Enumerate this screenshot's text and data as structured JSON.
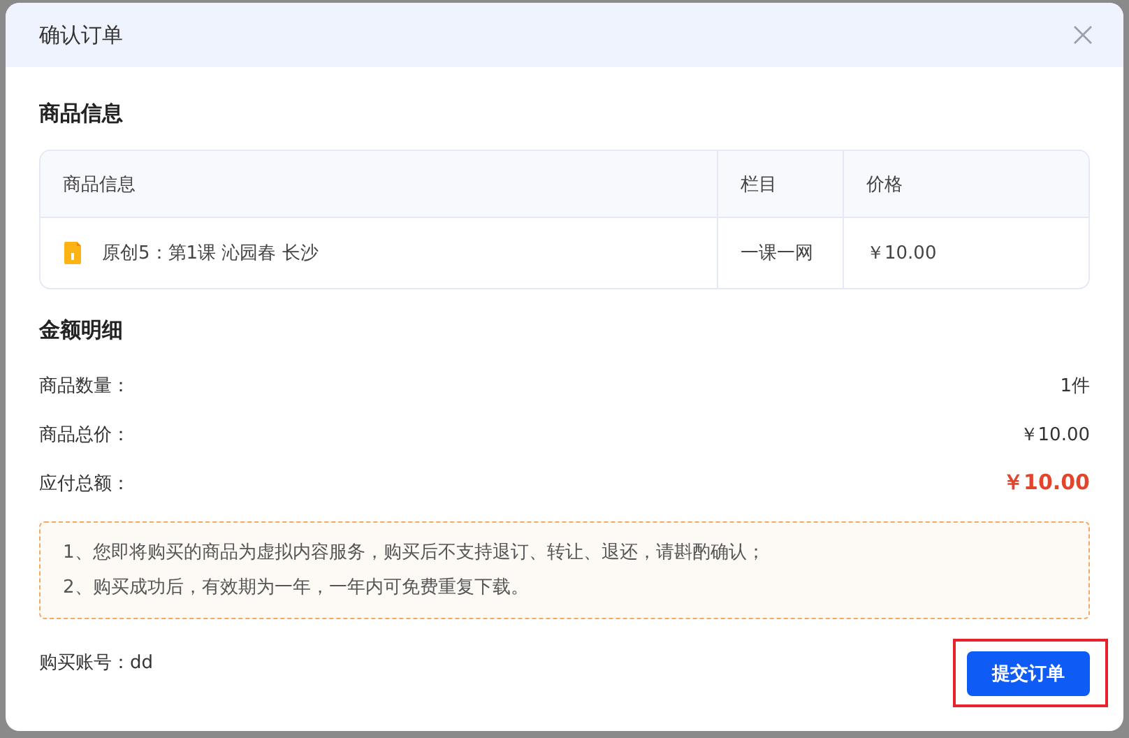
{
  "dialog": {
    "title": "确认订单"
  },
  "product_section": {
    "title": "商品信息",
    "table": {
      "columns": [
        "商品信息",
        "栏目",
        "价格"
      ],
      "rows": [
        {
          "name": "原创5：第1课 沁园春 长沙",
          "category": "一课一网",
          "price": "￥10.00"
        }
      ]
    }
  },
  "amount_section": {
    "title": "金额明细",
    "rows": [
      {
        "label": "商品数量：",
        "value": "1件",
        "emphasis": false
      },
      {
        "label": "商品总价：",
        "value": "￥10.00",
        "emphasis": false
      },
      {
        "label": "应付总额：",
        "value": "￥10.00",
        "emphasis": true
      }
    ]
  },
  "notice": [
    "1、您即将购买的商品为虚拟内容服务，购买后不支持退订、转让、退还，请斟酌确认；",
    "2、购买成功后，有效期为一年，一年内可免费重复下载。"
  ],
  "account": "购买账号：dd",
  "submit_button": {
    "label": "提交订单",
    "highlighted": true
  }
}
